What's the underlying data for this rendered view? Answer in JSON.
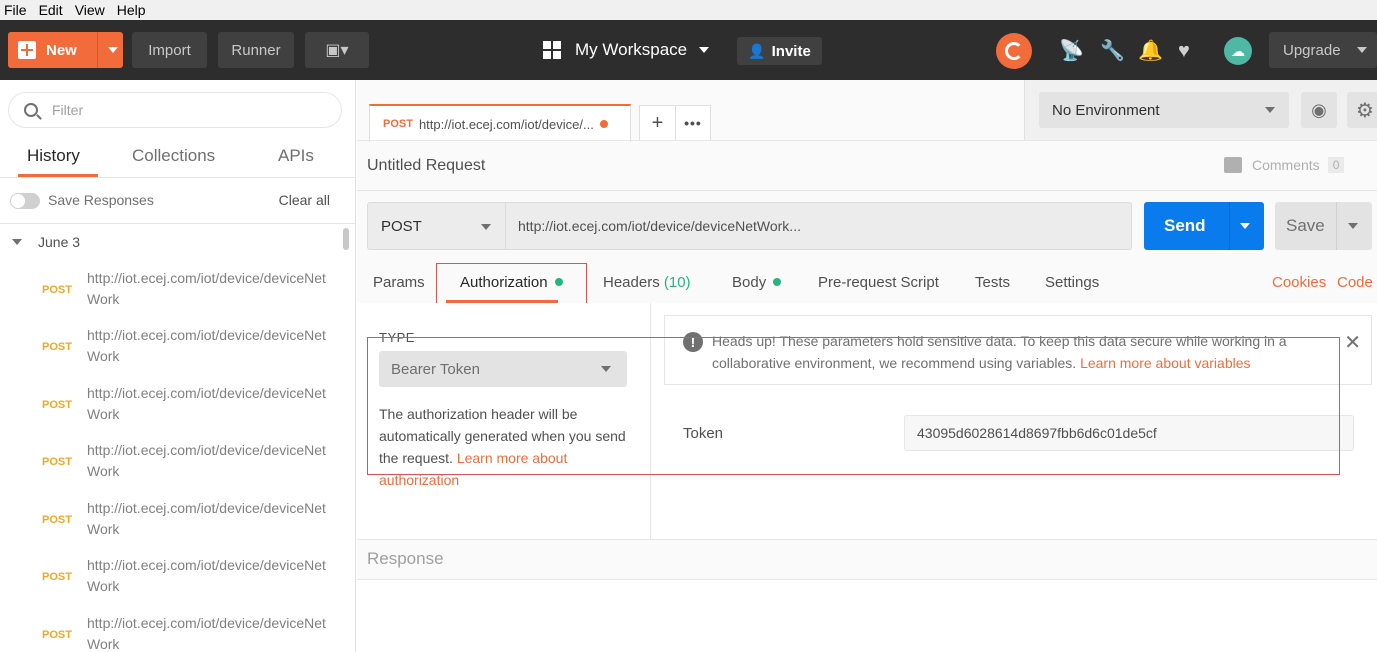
{
  "menu": [
    "File",
    "Edit",
    "View",
    "Help"
  ],
  "toolbar": {
    "new_label": "New",
    "import_label": "Import",
    "runner_label": "Runner",
    "workspace_label": "My Workspace",
    "invite_label": "Invite",
    "upgrade_label": "Upgrade",
    "accent": "#f26b3a"
  },
  "sidebar": {
    "filter_placeholder": "Filter",
    "tabs": [
      "History",
      "Collections",
      "APIs"
    ],
    "save_responses_label": "Save Responses",
    "clear_all_label": "Clear all",
    "group_label": "June 3",
    "items": [
      {
        "method": "POST",
        "url": "http://iot.ecej.com/iot/device/deviceNetWork"
      },
      {
        "method": "POST",
        "url": "http://iot.ecej.com/iot/device/deviceNetWork"
      },
      {
        "method": "POST",
        "url": "http://iot.ecej.com/iot/device/deviceNetWork"
      },
      {
        "method": "POST",
        "url": "http://iot.ecej.com/iot/device/deviceNetWork"
      },
      {
        "method": "POST",
        "url": "http://iot.ecej.com/iot/device/deviceNetWork"
      },
      {
        "method": "POST",
        "url": "http://iot.ecej.com/iot/device/deviceNetWork"
      },
      {
        "method": "POST",
        "url": "http://iot.ecej.com/iot/device/deviceNetWork"
      }
    ]
  },
  "tab": {
    "method": "POST",
    "url": "http://iot.ecej.com/iot/device/..."
  },
  "environment": {
    "selected": "No Environment"
  },
  "request": {
    "name": "Untitled Request",
    "comments_label": "Comments",
    "comments_count": "0",
    "method": "POST",
    "url": "http://iot.ecej.com/iot/device/deviceNetWork...",
    "send_label": "Send",
    "save_label": "Save"
  },
  "request_tabs": {
    "params": "Params",
    "authorization": "Authorization",
    "headers": "Headers",
    "headers_count": "(10)",
    "body": "Body",
    "prerequest": "Pre-request Script",
    "tests": "Tests",
    "settings": "Settings",
    "cookies": "Cookies",
    "code": "Code"
  },
  "auth": {
    "type_label": "TYPE",
    "type_value": "Bearer Token",
    "description": "The authorization header will be automatically generated when you send the request.",
    "learn_link": "Learn more about authorization",
    "notice_text": "Heads up! These parameters hold sensitive data. To keep this data secure while working in a collaborative environment, we recommend using variables.",
    "notice_link": "Learn more about variables",
    "token_label": "Token",
    "token_value": "43095d6028614d8697fbb6d6c01de5cf"
  },
  "response": {
    "label": "Response"
  }
}
